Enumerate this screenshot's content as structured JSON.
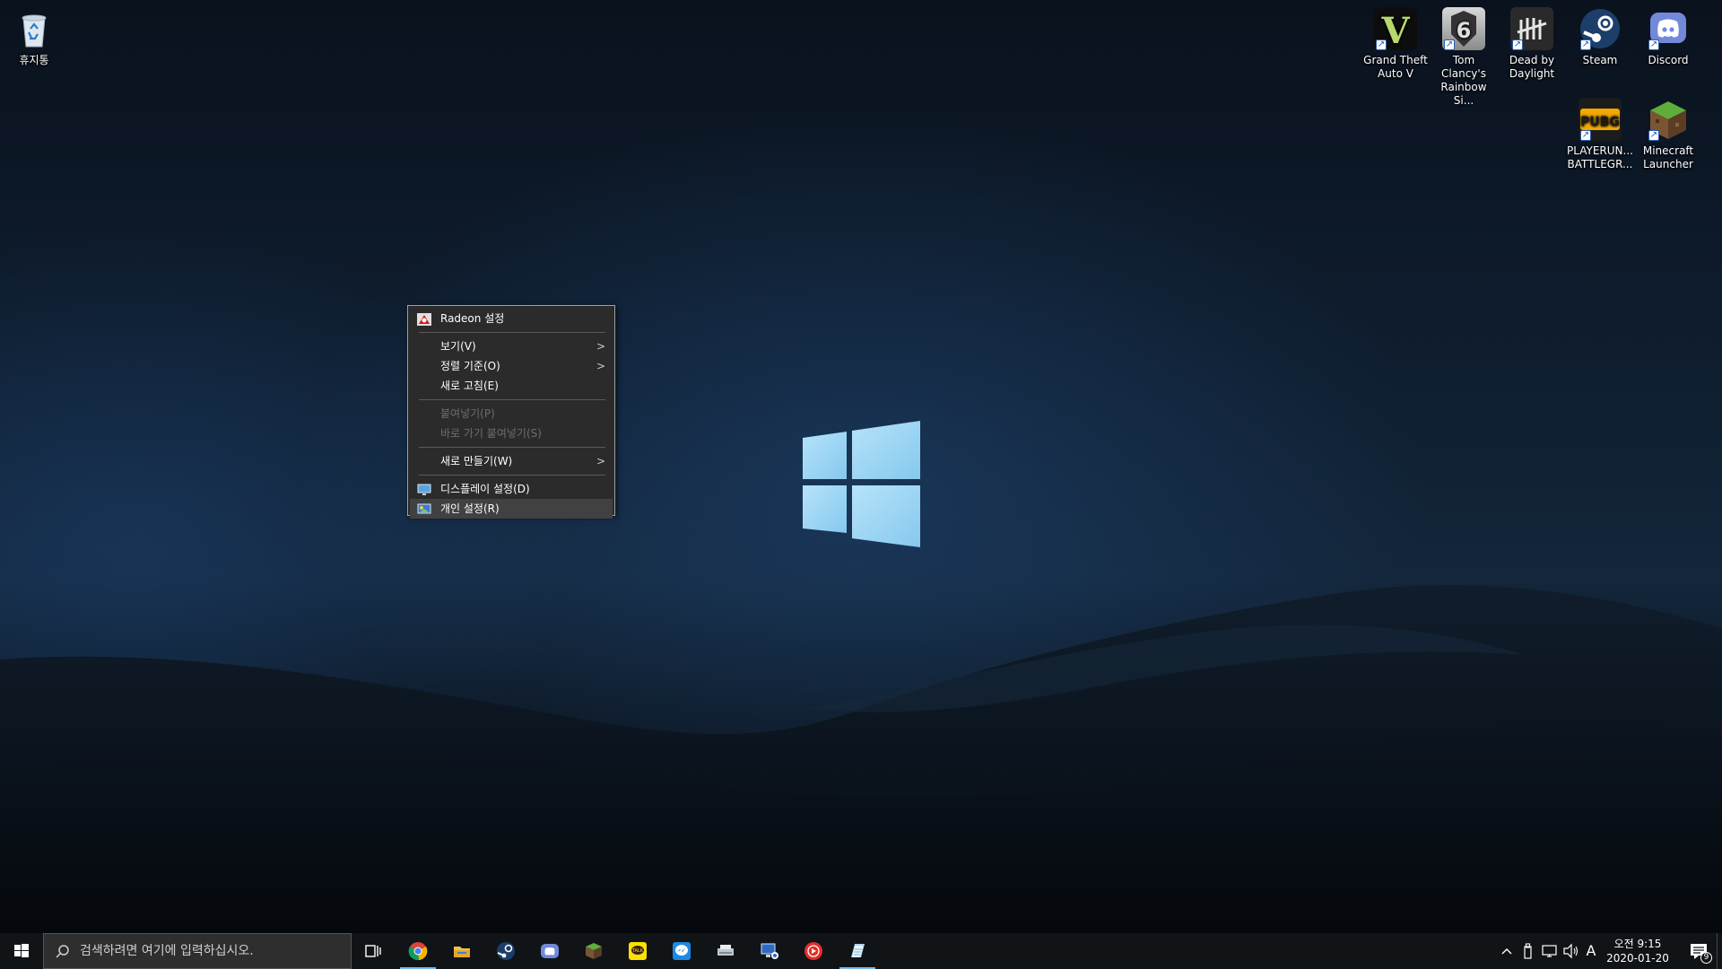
{
  "desktop": {
    "icons": [
      {
        "label": "휴지통",
        "icon": "recycle-bin-icon"
      },
      {
        "label": "Grand Theft\nAuto V",
        "icon": "gta-v-icon"
      },
      {
        "label": "Tom Clancy's\nRainbow Si...",
        "icon": "rainbow-six-icon"
      },
      {
        "label": "Dead by\nDaylight",
        "icon": "dead-by-daylight-icon"
      },
      {
        "label": "Steam",
        "icon": "steam-icon"
      },
      {
        "label": "Discord",
        "icon": "discord-icon"
      },
      {
        "label": "PLAYERUN...\nBATTLEGR...",
        "icon": "pubg-icon"
      },
      {
        "label": "Minecraft\nLauncher",
        "icon": "minecraft-icon"
      }
    ]
  },
  "context_menu": {
    "radeon": "Radeon 설정",
    "view": "보기(V)",
    "sort": "정렬 기준(O)",
    "refresh": "새로 고침(E)",
    "paste": "붙여넣기(P)",
    "paste_shortcut": "바로 가기 붙여넣기(S)",
    "new": "새로 만들기(W)",
    "display": "디스플레이 설정(D)",
    "personalize": "개인 설정(R)",
    "submenu_arrow": ">"
  },
  "taskbar": {
    "search_placeholder": "검색하려면 여기에 입력하십시오.",
    "apps": [
      "task-view-icon",
      "chrome-icon",
      "file-explorer-icon",
      "steam-icon",
      "discord-icon",
      "minecraft-icon",
      "kakaotalk-icon",
      "messenger-icon",
      "scanner-icon",
      "remote-desktop-icon",
      "youtube-music-icon",
      "notepad-icon"
    ],
    "tray": {
      "ime": "A",
      "time": "오전 9:15",
      "date": "2020-01-20",
      "notification_count": "9"
    }
  },
  "colors": {
    "taskbar_bg": "#111417",
    "menu_bg": "#2b2b2b",
    "accent": "#76b9ed",
    "windows_logo": "#9fd6f5"
  }
}
